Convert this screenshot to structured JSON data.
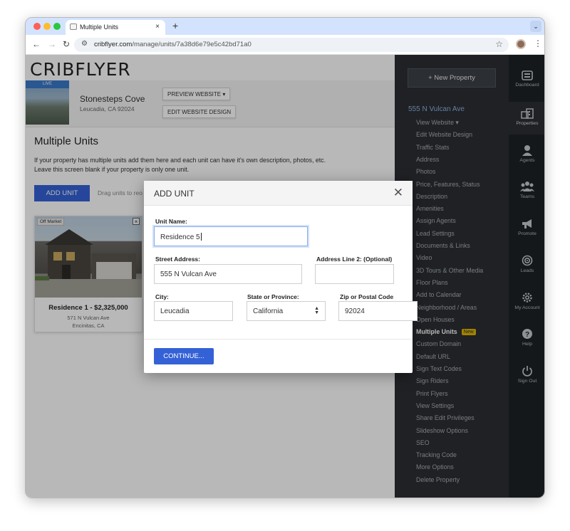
{
  "browser": {
    "tab_title": "Multiple Units",
    "tab_close": "×",
    "new_tab": "+",
    "url_domain": "cribflyer.com",
    "url_path": "/manage/units/7a38d6e79e5c42bd71a0",
    "colors": {
      "tabbar": "#d3e3fd",
      "close_dot": "#ff5f57",
      "min_dot": "#febc2e",
      "max_dot": "#28c840"
    }
  },
  "page": {
    "logo": "CRIBFLYER",
    "live_badge": "LIVE",
    "property_name": "Stonesteps Cove",
    "property_location": "Leucadia, CA 92024",
    "preview_button": "PREVIEW WEBSITE ▾",
    "edit_design_button": "EDIT WEBSITE DESIGN",
    "heading": "Multiple Units",
    "description_line1": "If your property has multiple units add them here and each unit can have it's own description, photos, etc.",
    "description_line2": "Leave this screen blank if your property is only one unit.",
    "add_unit_button": "ADD UNIT",
    "drag_hint": "Drag units to reo",
    "unit_card": {
      "status": "Off Market",
      "close": "×",
      "title": "Residence 1 - $2,325,000",
      "address": "571 N Vulcan Ave",
      "city": "Encinitas, CA"
    }
  },
  "sidebar": {
    "new_property": "+ New Property",
    "property_address": "555 N Vulcan Ave",
    "items": [
      "View Website ▾",
      "Edit Website Design",
      "Traffic Stats",
      "Address",
      "Photos",
      "Price, Features, Status",
      "Description",
      "Amenities",
      "Assign Agents",
      "Lead Settings",
      "Documents & Links",
      "Video",
      "3D Tours & Other Media",
      "Floor Plans",
      "Add to Calendar",
      "Neighborhood / Areas",
      "Open Houses",
      "Multiple Units",
      "Custom Domain",
      "Default URL",
      "Sign Text Codes",
      "Sign Riders",
      "Print Flyers",
      "View Settings",
      "Share Edit Privileges",
      "Slideshow Options",
      "SEO",
      "Tracking Code",
      "More Options",
      "Delete Property"
    ],
    "new_badge": "New",
    "icon_nav": [
      {
        "label": "Dashboard",
        "icon": "dashboard-icon"
      },
      {
        "label": "Properties",
        "icon": "properties-icon"
      },
      {
        "label": "Agents",
        "icon": "agent-icon"
      },
      {
        "label": "Teams",
        "icon": "teams-icon"
      },
      {
        "label": "Promote",
        "icon": "megaphone-icon"
      },
      {
        "label": "Leads",
        "icon": "target-icon"
      },
      {
        "label": "My Account",
        "icon": "gear-icon"
      },
      {
        "label": "Help",
        "icon": "help-icon"
      },
      {
        "label": "Sign Out",
        "icon": "power-icon"
      }
    ]
  },
  "modal": {
    "title": "ADD UNIT",
    "close": "✕",
    "unit_name_label": "Unit Name:",
    "unit_name_value": "Residence 5",
    "street_label": "Street Address:",
    "street_value": "555 N Vulcan Ave",
    "line2_label": "Address Line 2: (Optional)",
    "line2_value": "",
    "city_label": "City:",
    "city_value": "Leucadia",
    "state_label": "State or Province:",
    "state_value": "California",
    "zip_label": "Zip or Postal Code",
    "zip_value": "92024",
    "continue_button": "CONTINUE..."
  }
}
